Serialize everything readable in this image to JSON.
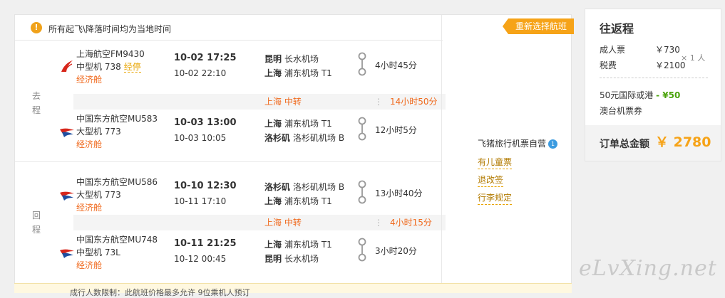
{
  "notice": {
    "icon": "warning-icon",
    "text": "所有起飞\\降落时间均为当地时间"
  },
  "right": {
    "reselect": "重新选择航班",
    "seller": "飞猪旅行机票自营",
    "seller_badge": "1",
    "links": [
      "有儿童票",
      "退改签",
      "行李规定"
    ]
  },
  "outbound": {
    "label": "去程",
    "segments": [
      {
        "airline": "上海航空FM9430",
        "aircraft": "中型机 738",
        "stop": "经停",
        "cabin": "经济舱",
        "dep": "10-02 17:25",
        "arr": "10-02 22:10",
        "from_city": "昆明",
        "from_airport": "长水机场",
        "to_city": "上海",
        "to_airport": "浦东机场 T1",
        "duration": "4小时45分",
        "logo": "shanghai-airlines-logo-icon"
      },
      {
        "airline": "中国东方航空MU583",
        "aircraft": "大型机 773",
        "stop": "",
        "cabin": "经济舱",
        "dep": "10-03 13:00",
        "arr": "10-03 10:05",
        "from_city": "上海",
        "from_airport": "浦东机场 T1",
        "to_city": "洛杉矶",
        "to_airport": "洛杉矶机场 B",
        "duration": "12小时5分",
        "logo": "china-eastern-logo-icon"
      }
    ],
    "transfer": {
      "city": "上海  中转",
      "duration": "14小时50分"
    }
  },
  "return": {
    "label": "回程",
    "segments": [
      {
        "airline": "中国东方航空MU586",
        "aircraft": "大型机 773",
        "stop": "",
        "cabin": "经济舱",
        "dep": "10-10 12:30",
        "arr": "10-11 17:10",
        "from_city": "洛杉矶",
        "from_airport": "洛杉矶机场 B",
        "to_city": "上海",
        "to_airport": "浦东机场 T1",
        "duration": "13小时40分",
        "logo": "china-eastern-logo-icon"
      },
      {
        "airline": "中国东方航空MU748",
        "aircraft": "中型机 73L",
        "stop": "",
        "cabin": "经济舱",
        "dep": "10-11 21:25",
        "arr": "10-12 00:45",
        "from_city": "上海",
        "from_airport": "浦东机场 T1",
        "to_city": "昆明",
        "to_airport": "长水机场",
        "duration": "3小时20分",
        "logo": "china-eastern-logo-icon"
      }
    ],
    "transfer": {
      "city": "上海  中转",
      "duration": "4小时15分"
    }
  },
  "summary": {
    "title": "往返程",
    "adult_label": "成人票",
    "adult_val": "￥730",
    "tax_label": "税费",
    "tax_val": "￥2100",
    "multiplier": "× 1 人",
    "promo_text": "50元国际或港澳台机票券",
    "promo_prefix": "50元国际或港",
    "promo_suffix": "澳台机票券",
    "promo_val": "- ¥50",
    "total_label": "订单总金额",
    "total_val": "￥ 2780"
  },
  "bottom": {
    "text": "成行人数限制：此航班价格最多允许 9位乘机人预订"
  },
  "watermark": "eLvXing.net",
  "colors": {
    "accent": "#f6a318",
    "cabin": "#f06a1e",
    "promo": "#4aa30a",
    "link": "#b27a00"
  }
}
